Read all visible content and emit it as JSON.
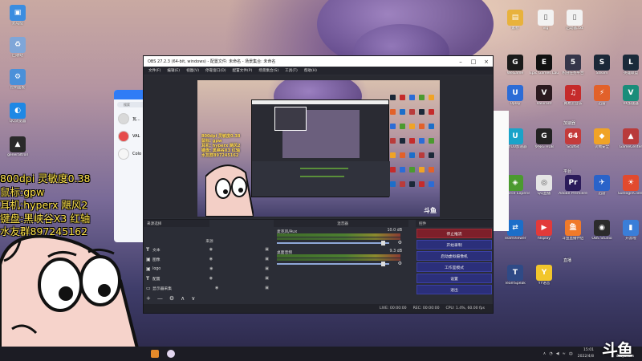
{
  "desktop_left_icons": [
    {
      "label": "此电脑",
      "color": "#3b8de0",
      "glyph": "▣",
      "icon": "computer-icon"
    },
    {
      "label": "回收站",
      "color": "#7fa6d8",
      "glyph": "♻",
      "icon": "recycle-bin-icon"
    },
    {
      "label": "控制面板",
      "color": "#4a90d9",
      "glyph": "⚙",
      "icon": "control-panel-icon"
    },
    {
      "label": "QQ浏览器",
      "color": "#1e88e5",
      "glyph": "◐",
      "icon": "browser-icon"
    },
    {
      "label": "generaltroll",
      "color": "#2a2a2a",
      "glyph": "▲",
      "icon": "game-icon"
    }
  ],
  "desktop_right_icons": [
    {
      "label": "素材",
      "color": "#e8b23c",
      "glyph": "▤",
      "icon": "folder-icon"
    },
    {
      "label": "vlg",
      "color": "#f2f2f2",
      "glyph": "▯",
      "icon": "file-icon"
    },
    {
      "label": "启动器.txt",
      "color": "#f2f2f2",
      "glyph": "▯",
      "icon": "text-file-icon"
    },
    {
      "label": "WeGame",
      "color": "#1a1a1a",
      "glyph": "G",
      "icon": "wegame-icon"
    },
    {
      "label": "Epic Games Launcher",
      "color": "#111111",
      "glyph": "E",
      "icon": "epic-games-icon"
    },
    {
      "label": "积分任务平台",
      "color": "#35364a",
      "glyph": "5",
      "icon": "task-platform-icon"
    },
    {
      "label": "Steam",
      "color": "#1b2838",
      "glyph": "S",
      "icon": "steam-icon"
    },
    {
      "label": "英雄联盟",
      "color": "#1a2a3a",
      "glyph": "L",
      "icon": "league-icon"
    },
    {
      "label": "Uplay",
      "color": "#2c6cd6",
      "glyph": "U",
      "icon": "uplay-icon"
    },
    {
      "label": "Valorant",
      "color": "#2b1a1f",
      "glyph": "V",
      "icon": "valorant-icon"
    },
    {
      "label": "网易云音乐",
      "color": "#c52b2b",
      "glyph": "♫",
      "icon": "music-icon"
    },
    {
      "label": "迅雷",
      "color": "#e2612a",
      "glyph": "⚡",
      "icon": "thunder-icon"
    },
    {
      "label": "VK加速器",
      "color": "#1a8d7a",
      "glyph": "V",
      "icon": "vk-accelerator-icon"
    },
    {
      "label": "网易UU加速器",
      "color": "#1aa3c9",
      "glyph": "U",
      "icon": "uu-accelerator-icon"
    },
    {
      "label": "罗技G HUB",
      "color": "#222222",
      "glyph": "G",
      "icon": "logitech-icon"
    },
    {
      "label": "Scuf64",
      "color": "#c43b3b",
      "glyph": "64",
      "icon": "scuf-icon"
    },
    {
      "label": "火绒安全",
      "color": "#f0a326",
      "glyph": "◆",
      "icon": "huorong-icon"
    },
    {
      "label": "GameCenter",
      "color": "#b93b3b",
      "glyph": "▲",
      "icon": "game-center-icon"
    },
    {
      "label": "GeForce Experience",
      "color": "#4b9a2f",
      "glyph": "◈",
      "icon": "nvidia-icon"
    },
    {
      "label": "QQ直播",
      "color": "#e5e5e5",
      "glyph": "◎",
      "icon": "qq-live-icon"
    },
    {
      "label": "Adobe Premiere",
      "color": "#2b1b5a",
      "glyph": "Pr",
      "icon": "premiere-icon"
    },
    {
      "label": "迅游",
      "color": "#2a63c9",
      "glyph": "✈",
      "icon": "xunyou-icon"
    },
    {
      "label": "SunloginClient",
      "color": "#e24a2e",
      "glyph": "☀",
      "icon": "sunlogin-icon"
    },
    {
      "label": "TeamViewer",
      "color": "#1c6ec9",
      "glyph": "⇄",
      "icon": "teamviewer-icon"
    },
    {
      "label": "hlsplay",
      "color": "#e23a3a",
      "glyph": "▶",
      "icon": "player-icon"
    },
    {
      "label": "斗鱼直播伴侣",
      "color": "#f07a2a",
      "glyph": "鱼",
      "icon": "douyu-icon"
    },
    {
      "label": "OBS Studio",
      "color": "#2b2b2b",
      "glyph": "◉",
      "icon": "obs-icon"
    },
    {
      "label": "开黑啦",
      "color": "#3a7ed8",
      "glyph": "▮",
      "icon": "kaiheila-icon"
    },
    {
      "label": "TeamSpeak",
      "color": "#2f4a86",
      "glyph": "T",
      "icon": "teamspeak-icon"
    },
    {
      "label": "YY语音",
      "color": "#f2c62c",
      "glyph": "Y",
      "icon": "yy-icon"
    }
  ],
  "desktop_groups": [
    "加速器",
    "平台",
    "直播"
  ],
  "chat": {
    "search_placeholder": "搜索",
    "rows": [
      {
        "name": "瓦...",
        "color": "#d9d9d9"
      },
      {
        "name": "VAL",
        "color": "#e64b4b"
      },
      {
        "name": "Colo",
        "color": "#f6f6f6"
      }
    ]
  },
  "obs": {
    "title": "OBS 27.2.3 (64-bit, windows) - 配置文件: 未命名 - 场景集合: 未命名",
    "menu": [
      "文件(F)",
      "编辑(E)",
      "视图(V)",
      "停靠窗口(D)",
      "配置文件(P)",
      "场景集合(S)",
      "工具(T)",
      "帮助(H)"
    ],
    "scenes_header": "来源选择",
    "sources_header": "来源",
    "sources": [
      {
        "type": "T",
        "name": "文本",
        "icon": "text-source-icon"
      },
      {
        "type": "▣",
        "name": "图像",
        "icon": "image-source-icon"
      },
      {
        "type": "▣",
        "name": "logo",
        "icon": "image-source-icon"
      },
      {
        "type": "T",
        "name": "配置",
        "icon": "text-source-icon"
      },
      {
        "type": "▭",
        "name": "显示器采集",
        "icon": "display-capture-icon"
      }
    ],
    "source_toolbar": [
      "+",
      "—",
      "⚙",
      "∧",
      "∨"
    ],
    "mixer_header": "混音器",
    "mixer": [
      {
        "name": "麦克风/Aux",
        "db": "10.0 dB"
      },
      {
        "name": "桌面音频",
        "db": "9.3 dB"
      }
    ],
    "controls_header": "控件",
    "controls": [
      "停止推流",
      "开始录制",
      "启动虚拟摄像机",
      "工作室模式",
      "设置",
      "退出"
    ],
    "status": {
      "live": "LIVE: 00:00:00",
      "rec": "REC: 00:00:00",
      "cpu": "CPU: 1.4%, 60.00 fps"
    },
    "canvas_text": [
      "800dpi 灵敏度0.38",
      "鼠标: gpw",
      "耳机: hyperx 飓风2",
      "键盘: 黑峡谷X3 红轴",
      "水友群897245162"
    ]
  },
  "overlay": {
    "lines": [
      "800dpi 灵敏度0.38",
      "鼠标:gpw",
      "耳机:hyperx 飓风2",
      "键盘:黑峡谷X3 红轴",
      "水友群897245162"
    ]
  },
  "brand": {
    "name": "斗鱼",
    "sub": "douyu.com"
  },
  "clock": {
    "time": "15:01",
    "date": "2022/4/8"
  },
  "colors": {
    "overlay_text": "#ffe34a",
    "obs_bg": "#2b2d36",
    "stop_button": "#7d1f2a",
    "control_button": "#2b2f7a"
  }
}
